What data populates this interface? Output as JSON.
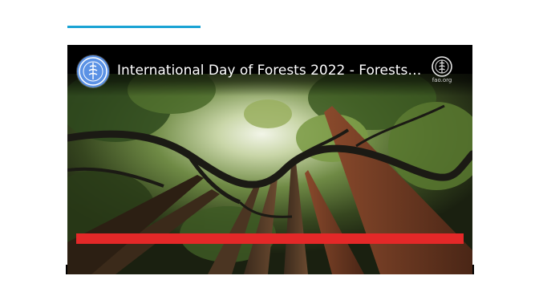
{
  "colors": {
    "accent_line": "#1aa3d4",
    "red_banner": "#e42828",
    "avatar_blue": "#5b92e5"
  },
  "video": {
    "title": "International Day of Forests 2022 - Forests an...",
    "channel_avatar_icon": "fao-logo-icon",
    "brand_logo_icon": "fao-emblem-icon",
    "brand_url": "fao.org",
    "thumbnail": "forest-canopy-image"
  }
}
